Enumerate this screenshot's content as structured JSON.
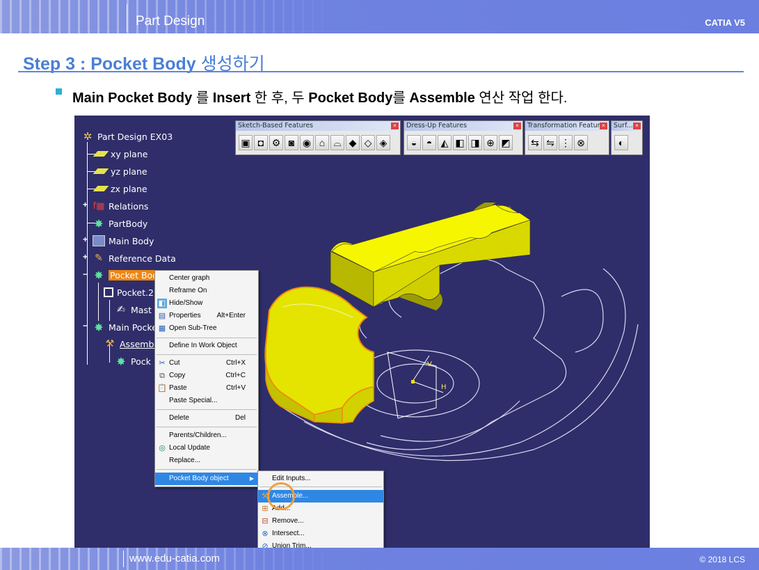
{
  "header": {
    "title": "Part Design",
    "product": "CATIA V5"
  },
  "footer": {
    "url": "www.edu-catia.com",
    "copyright": "© 2018 LCS"
  },
  "slide": {
    "title_en": "Step 3 : Pocket Body",
    "title_kr": " 생성하기",
    "bullet": {
      "parts": [
        "Main Pocket Body",
        " 를 ",
        "Insert",
        " 한 후, 두 ",
        "Pocket Body",
        "를 ",
        "Assemble",
        " 연산 작업 한다."
      ]
    }
  },
  "toolbars": [
    {
      "title": "Sketch-Based Features",
      "icons": [
        "pad-icon",
        "pocket-icon",
        "shaft-icon",
        "groove-icon",
        "hole-icon",
        "rib-icon",
        "slot-icon",
        "stiffener-icon",
        "loft-icon",
        "remove-loft-icon"
      ]
    },
    {
      "title": "Dress-Up Features",
      "icons": [
        "fillet-icon",
        "chamfer-icon",
        "draft-icon",
        "shell-icon",
        "thickness-icon",
        "thread-icon",
        "remove-face-icon"
      ]
    },
    {
      "title": "Transformation Features",
      "icons": [
        "translation-icon",
        "mirror-icon",
        "pattern-icon",
        "scaling-icon"
      ]
    },
    {
      "title": "Surf...",
      "icons": [
        "split-icon"
      ]
    }
  ],
  "tree": {
    "root": "Part Design EX03",
    "items": [
      {
        "label": "xy plane",
        "icon": "plane-icon"
      },
      {
        "label": "yz plane",
        "icon": "plane-icon"
      },
      {
        "label": "zx plane",
        "icon": "plane-icon"
      },
      {
        "label": "Relations",
        "icon": "relations-icon"
      },
      {
        "label": "PartBody",
        "icon": "gear-icon"
      },
      {
        "label": "Main Body",
        "icon": "body-icon"
      },
      {
        "label": "Reference Data",
        "icon": "reference-icon"
      },
      {
        "label": "Pocket Bod",
        "icon": "gear-icon",
        "selected": true
      },
      {
        "label": "Pocket.2",
        "icon": "pocket-icon"
      },
      {
        "label": "Mast",
        "icon": "sketch-icon"
      },
      {
        "label": "Main Pocke",
        "icon": "gear-icon"
      },
      {
        "label": "Assembl",
        "icon": "assemble-icon"
      },
      {
        "label": "Pock",
        "icon": "gear-icon"
      }
    ]
  },
  "context_menu": {
    "items": [
      {
        "label": "Center graph",
        "shortcut": ""
      },
      {
        "label": "Reframe On",
        "shortcut": ""
      },
      {
        "label": "Hide/Show",
        "shortcut": "",
        "icon": "hide-show-icon"
      },
      {
        "label": "Properties",
        "shortcut": "Alt+Enter",
        "icon": "properties-icon"
      },
      {
        "label": "Open Sub-Tree",
        "shortcut": "",
        "icon": "subtree-icon"
      },
      {
        "label": "Define In Work Object",
        "shortcut": ""
      },
      {
        "label": "Cut",
        "shortcut": "Ctrl+X",
        "icon": "cut-icon"
      },
      {
        "label": "Copy",
        "shortcut": "Ctrl+C",
        "icon": "copy-icon"
      },
      {
        "label": "Paste",
        "shortcut": "Ctrl+V",
        "icon": "paste-icon"
      },
      {
        "label": "Paste Special...",
        "shortcut": ""
      },
      {
        "label": "Delete",
        "shortcut": "Del"
      },
      {
        "label": "Parents/Children...",
        "shortcut": ""
      },
      {
        "label": "Local Update",
        "shortcut": "",
        "icon": "update-icon"
      },
      {
        "label": "Replace...",
        "shortcut": ""
      },
      {
        "label": "Pocket Body object",
        "shortcut": "",
        "submenu": true,
        "highlighted": true
      }
    ]
  },
  "submenu": {
    "items": [
      {
        "label": "Edit Inputs..."
      },
      {
        "label": "Assemble...",
        "highlighted": true,
        "icon": "assemble-icon"
      },
      {
        "label": "Add...",
        "icon": "add-icon"
      },
      {
        "label": "Remove...",
        "icon": "remove-icon"
      },
      {
        "label": "Intersect...",
        "icon": "intersect-icon"
      },
      {
        "label": "Union Trim...",
        "icon": "union-trim-icon"
      }
    ]
  },
  "colors": {
    "viewport_bg": "#2f2e6a",
    "solid": "#e4e400",
    "selection": "#f0860f",
    "accent": "#4a7fd4"
  }
}
